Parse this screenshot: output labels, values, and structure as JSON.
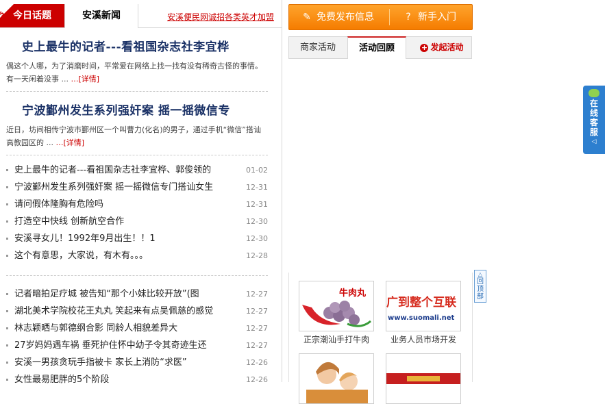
{
  "tabs": {
    "hot_label": "今日话题",
    "news_label": "安溪新闻",
    "recruit_link": "安溪便民网诚招各类英才加盟"
  },
  "featured": [
    {
      "title": "史上最牛的记者---看祖国杂志社李宜桦",
      "summary": "偶这个人哪，为了消磨时间，平常爱在网络上找一找有没有稀奇古怪的事情。有一天闲着没事 ...",
      "more": "…[详情]"
    },
    {
      "title": "宁波鄞州发生系列强奸案 摇一摇微信专",
      "summary": "近日，坊间相传宁波市鄞州区一个叫曹力(化名)的男子，通过手机“微信”搭讪高教园区的 ...",
      "more": "…[详情]"
    }
  ],
  "news_list_1": [
    {
      "title": "史上最牛的记者---看祖国杂志社李宜桦、郭俊领的",
      "date": "01-02"
    },
    {
      "title": "宁波鄞州发生系列强奸案 摇一摇微信专门搭讪女生",
      "date": "12-31"
    },
    {
      "title": "请问假体隆胸有危险吗",
      "date": "12-31"
    },
    {
      "title": "打造空中快线 创新航空合作",
      "date": "12-30"
    },
    {
      "title": "安溪寻女儿！1992年9月出生！！1",
      "date": "12-30"
    },
    {
      "title": "这个有意思，大家说，有木有。。。",
      "date": "12-28"
    }
  ],
  "news_list_2": [
    {
      "title": "记者暗拍足疗城 被告知“那个小妹比较开放”(图",
      "date": "12-27"
    },
    {
      "title": "湖北美术学院校花王丸丸 笑起来有点吴佩慈的感觉",
      "date": "12-27"
    },
    {
      "title": "林志颖晒与郭德纲合影 同龄人相貌差异大",
      "date": "12-27"
    },
    {
      "title": "27岁妈妈遇车祸 垂死护住怀中幼子令其奇迹生还",
      "date": "12-27"
    },
    {
      "title": "安溪一男孩贪玩手指被卡 家长上消防“求医”",
      "date": "12-26"
    },
    {
      "title": "女性最易肥胖的5个阶段",
      "date": "12-26"
    }
  ],
  "buttons": {
    "publish": "免费发布信息",
    "guide": "新手入门",
    "publish_icon": "pencil-icon",
    "guide_icon": "question-icon"
  },
  "activity_tabs": {
    "merchant": "商家活动",
    "review": "活动回顾",
    "launch": "发起活动"
  },
  "ads": [
    {
      "caption": "正宗潮汕手打牛肉",
      "img_text": "牛肉丸"
    },
    {
      "caption": "业务人员市场开发",
      "img_text": "广到整个互联",
      "img_sub": "www.suomali.net"
    },
    {
      "caption": "",
      "img_text": ""
    },
    {
      "caption": "",
      "img_text": ""
    }
  ],
  "service": {
    "label": "在线客服",
    "arrow": "◁"
  },
  "totop": {
    "label": "回顶部"
  },
  "colors": {
    "accent_red": "#cc0000",
    "title_blue": "#1a3166",
    "orange": "#f57c00",
    "service_blue": "#2d7fcf"
  }
}
